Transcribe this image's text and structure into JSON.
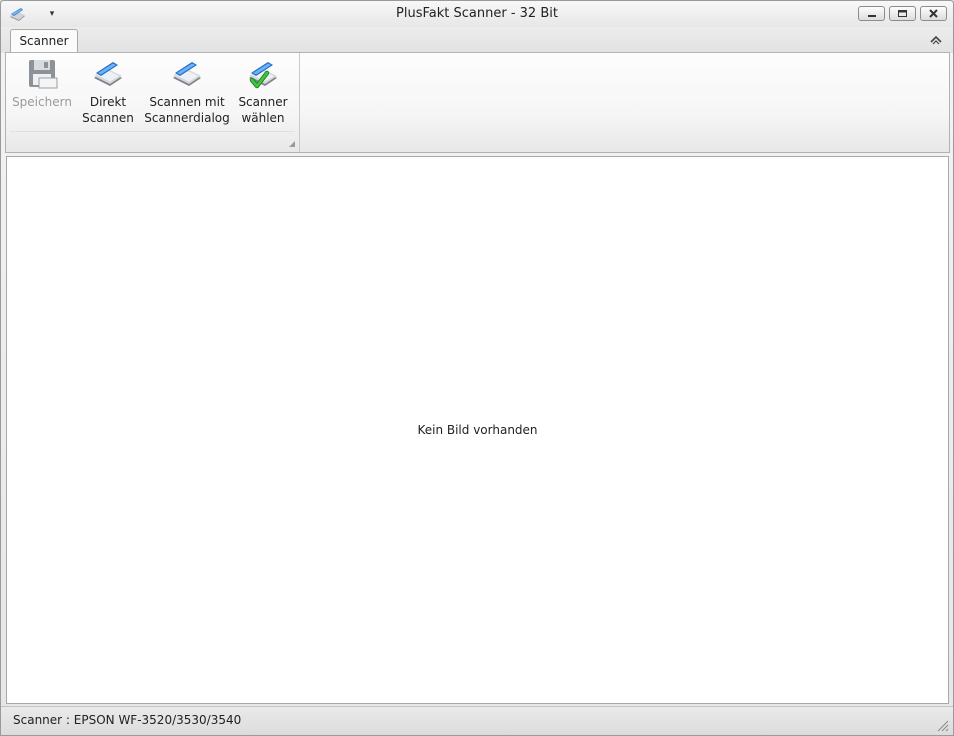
{
  "window": {
    "title": "PlusFakt Scanner - 32 Bit",
    "app_icon": "scanner-app-icon",
    "qat_arrow": "▾"
  },
  "ribbon": {
    "tabs": [
      {
        "label": "Scanner",
        "active": true
      }
    ],
    "buttons": {
      "save": {
        "label": "Speichern",
        "icon": "floppy-disk-icon",
        "enabled": false
      },
      "direct_scan": {
        "label": "Direkt\nScannen",
        "icon": "scanner-icon"
      },
      "scan_dialog": {
        "label": "Scannen mit\nScannerdialog",
        "icon": "scanner-icon"
      },
      "choose_scanner": {
        "label": "Scanner\nwählen",
        "icon": "scanner-check-icon"
      }
    }
  },
  "content": {
    "empty_message": "Kein Bild vorhanden"
  },
  "statusbar": {
    "text": "Scanner : EPSON WF-3520/3530/3540"
  },
  "colors": {
    "scanner_blue": "#2f7fd6",
    "check_green": "#2aa32a",
    "disabled_text": "#9a9a9a"
  }
}
